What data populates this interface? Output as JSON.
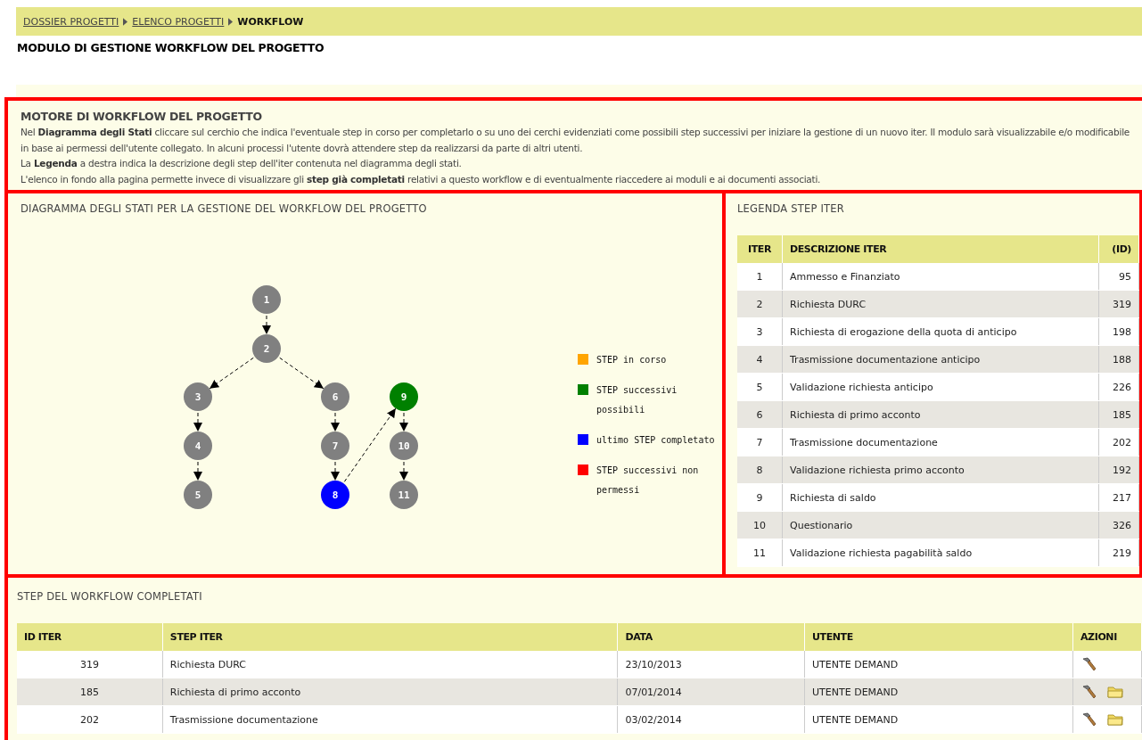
{
  "breadcrumb": [
    {
      "label": "DOSSIER PROGETTI",
      "kind": "link"
    },
    {
      "label": "ELENCO PROGETTI",
      "kind": "link"
    },
    {
      "label": "WORKFLOW",
      "kind": "current"
    }
  ],
  "page_title": "MODULO DI GESTIONE WORKFLOW DEL PROGETTO",
  "intro": {
    "title": "MOTORE DI WORKFLOW DEL PROGETTO",
    "paragraphs": [
      "Nel **Diagramma degli Stati** cliccare sul cerchio che indica l'eventuale step in corso per completarlo o su uno dei cerchi evidenziati come possibili step successivi per iniziare la gestione di un nuovo iter. Il modulo sarà visualizzabile e/o modificabile in base ai permessi dell'utente collegato. In alcuni processi l'utente dovrà attendere step da realizzarsi da parte di altri utenti.",
      "La **Legenda** a destra indica la descrizione degli step dell'iter contenuta nel diagramma degli stati.",
      "L'elenco in fondo alla pagina permette invece di visualizzare gli **step già completati** relativi a questo workflow e di eventualmente riaccedere ai moduli e ai documenti associati."
    ]
  },
  "diagram": {
    "title": "DIAGRAMMA DEGLI STATI PER LA GESTIONE DEL WORKFLOW DEL PROGETTO",
    "nodes": [
      {
        "label": "1",
        "color": "#808080"
      },
      {
        "label": "2",
        "color": "#808080"
      },
      {
        "label": "3",
        "color": "#808080"
      },
      {
        "label": "4",
        "color": "#808080"
      },
      {
        "label": "5",
        "color": "#808080"
      },
      {
        "label": "6",
        "color": "#808080"
      },
      {
        "label": "7",
        "color": "#808080"
      },
      {
        "label": "8",
        "color": "#0000ff"
      },
      {
        "label": "9",
        "color": "#008000"
      },
      {
        "label": "10",
        "color": "#808080"
      },
      {
        "label": "11",
        "color": "#808080"
      }
    ],
    "legend": [
      {
        "label": "STEP in corso",
        "color": "#ffa500"
      },
      {
        "label": "STEP successivi possibili",
        "color": "#008000"
      },
      {
        "label": "ultimo STEP completato",
        "color": "#0000ff"
      },
      {
        "label": "STEP successivi non permessi",
        "color": "#ff0000"
      }
    ]
  },
  "legend_table": {
    "title": "LEGENDA STEP ITER",
    "columns": [
      "ITER",
      "DESCRIZIONE ITER",
      "(ID)"
    ],
    "rows": [
      [
        "1",
        "Ammesso e Finanziato",
        "95"
      ],
      [
        "2",
        "Richiesta DURC",
        "319"
      ],
      [
        "3",
        "Richiesta di erogazione della quota di anticipo",
        "198"
      ],
      [
        "4",
        "Trasmissione documentazione anticipo",
        "188"
      ],
      [
        "5",
        "Validazione richiesta anticipo",
        "226"
      ],
      [
        "6",
        "Richiesta di primo acconto",
        "185"
      ],
      [
        "7",
        "Trasmissione documentazione",
        "202"
      ],
      [
        "8",
        "Validazione richiesta primo acconto",
        "192"
      ],
      [
        "9",
        "Richiesta di saldo",
        "217"
      ],
      [
        "10",
        "Questionario",
        "326"
      ],
      [
        "11",
        "Validazione richiesta pagabilità saldo",
        "219"
      ]
    ]
  },
  "completed": {
    "title": "STEP DEL WORKFLOW COMPLETATI",
    "columns": [
      "ID ITER",
      "STEP ITER",
      "DATA",
      "UTENTE",
      "AZIONI"
    ],
    "rows": [
      {
        "cells": [
          "319",
          "Richiesta DURC",
          "23/10/2013",
          "UTENTE DEMAND"
        ],
        "actions": [
          {
            "kind": "edit"
          }
        ]
      },
      {
        "cells": [
          "185",
          "Richiesta di primo acconto",
          "07/01/2014",
          "UTENTE DEMAND"
        ],
        "actions": [
          {
            "kind": "edit"
          },
          {
            "kind": "documents"
          }
        ]
      },
      {
        "cells": [
          "202",
          "Trasmissione documentazione",
          "03/02/2014",
          "UTENTE DEMAND"
        ],
        "actions": [
          {
            "kind": "edit"
          },
          {
            "kind": "documents"
          }
        ]
      }
    ]
  }
}
